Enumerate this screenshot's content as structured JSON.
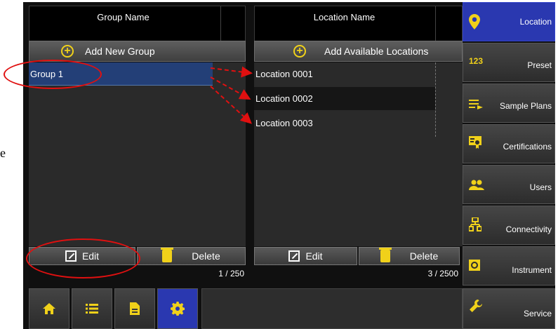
{
  "left_panel": {
    "header": "Group Name",
    "add_label": "Add New Group",
    "rows": [
      {
        "label": "Group 1",
        "selected": true
      }
    ],
    "edit_label": "Edit",
    "delete_label": "Delete",
    "count": "1 / 250"
  },
  "right_panel": {
    "header": "Location Name",
    "add_label": "Add Available Locations",
    "rows": [
      {
        "label": "Location 0001"
      },
      {
        "label": "Location 0002"
      },
      {
        "label": "Location 0003"
      }
    ],
    "edit_label": "Edit",
    "delete_label": "Delete",
    "count": "3 / 2500"
  },
  "sidebar": {
    "items": [
      {
        "label": "Location",
        "icon": "map-pin-icon",
        "active": true
      },
      {
        "label": "Preset",
        "icon": "preset-123-icon",
        "icon_text": "123"
      },
      {
        "label": "Sample Plans",
        "icon": "sample-plans-icon"
      },
      {
        "label": "Certifications",
        "icon": "certificate-icon"
      },
      {
        "label": "Users",
        "icon": "users-icon"
      },
      {
        "label": "Connectivity",
        "icon": "network-icon"
      },
      {
        "label": "Instrument",
        "icon": "instrument-icon"
      },
      {
        "label": "Service",
        "icon": "wrench-icon"
      }
    ]
  },
  "bottom_nav": {
    "items": [
      {
        "icon": "home-icon"
      },
      {
        "icon": "list-icon"
      },
      {
        "icon": "document-icon"
      },
      {
        "icon": "gear-icon",
        "active": true
      }
    ]
  },
  "page_fragment": "e",
  "colors": {
    "accent_blue": "#2a38b0",
    "selected_row": "#233f77",
    "icon_yellow": "#f0d11a",
    "annotation_red": "#e01010"
  }
}
